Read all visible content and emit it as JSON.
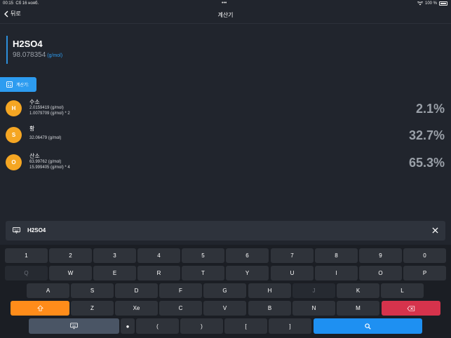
{
  "status_bar": {
    "time": "00:15",
    "date": "Сб 16 нояб.",
    "battery": "100 %"
  },
  "nav": {
    "back_label": "뒤로",
    "title": "계산기"
  },
  "formula": {
    "name": "H2SO4",
    "mass": "98.078354",
    "unit": "(g/mol)"
  },
  "calc_tab_label": "계산기:",
  "elements": [
    {
      "symbol": "H",
      "name": "수소",
      "line1": "2.0159419 (g/mol)",
      "line2": "1.0079709 (g/mol) * 2",
      "percent": "2.1%"
    },
    {
      "symbol": "S",
      "name": "황",
      "line1": "32.06479 (g/mol)",
      "line2": "",
      "percent": "32.7%"
    },
    {
      "symbol": "O",
      "name": "산소",
      "line1": "63.99762 (g/mol)",
      "line2": "15.999405 (g/mol) * 4",
      "percent": "65.3%"
    }
  ],
  "input": {
    "value": "H2SO4"
  },
  "keyboard": {
    "row1": [
      "1",
      "2",
      "3",
      "4",
      "5",
      "6",
      "7",
      "8",
      "9",
      "0"
    ],
    "row2": [
      "Q",
      "W",
      "E",
      "R",
      "T",
      "Y",
      "U",
      "I",
      "O",
      "P"
    ],
    "row3": [
      "A",
      "S",
      "D",
      "F",
      "G",
      "H",
      "J",
      "K",
      "L"
    ],
    "row4": [
      "Z",
      "Xe",
      "C",
      "V",
      "B",
      "N",
      "M"
    ],
    "row5": [
      "●",
      "(",
      ")",
      "[",
      "]"
    ]
  },
  "colors": {
    "accent_blue": "#2d9cf0",
    "badge": "#f5a623",
    "shift": "#ff8c1a",
    "delete": "#d6334c"
  }
}
